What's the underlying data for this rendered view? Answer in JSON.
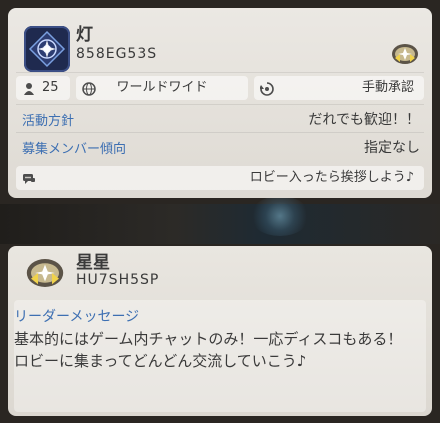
{
  "club": {
    "name": "灯",
    "id": "858EG53S",
    "members": "25",
    "region": "ワールドワイド",
    "approval": "手動承認",
    "policy_label": "活動方針",
    "policy_value": "だれでも歓迎！！",
    "recruit_label": "募集メンバー傾向",
    "recruit_value": "指定なし",
    "chat_message": "ロビー入ったら挨拶しよう♪"
  },
  "leader": {
    "name": "星星",
    "id": "HU7SH5SP",
    "message_label": "リーダーメッセージ",
    "message": "基本的にはゲーム内チャットのみ！一応ディスコもある！ロビーに集まってどんどん交流していこう♪"
  },
  "colors": {
    "accent_blue": "#3d6fb2",
    "panel": "#e9e6e0",
    "text": "#3a3a3a"
  },
  "icons": [
    "club-emblem-icon",
    "rank-badge-icon",
    "members-icon",
    "globe-icon",
    "approval-icon",
    "chat-icon"
  ]
}
